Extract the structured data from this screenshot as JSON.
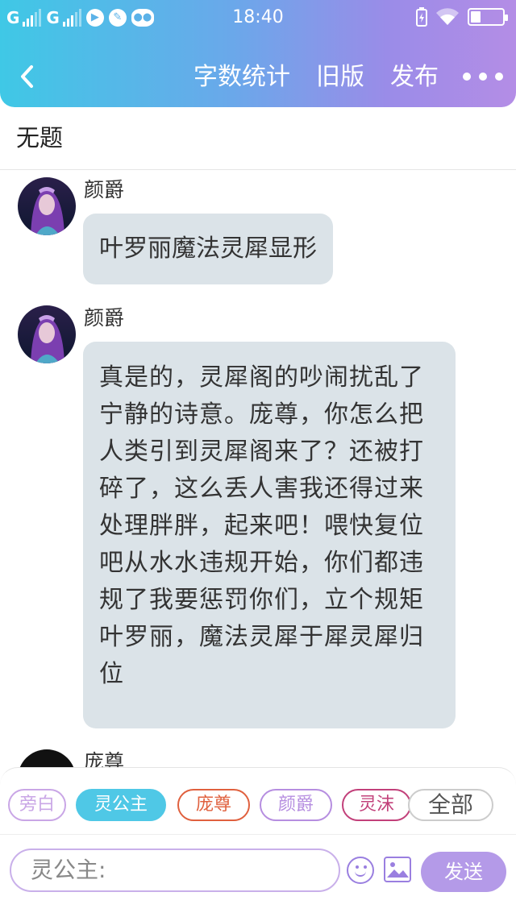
{
  "status_bar": {
    "carrier1": "G",
    "carrier2": "G",
    "time": "18:40"
  },
  "header": {
    "actions": [
      "字数统计",
      "旧版",
      "发布"
    ],
    "back_icon": "chevron-left-icon",
    "more_icon": "more-dots-icon"
  },
  "title": "无题",
  "messages": [
    {
      "sender": "颜爵",
      "text": "叶罗丽魔法灵犀显形"
    },
    {
      "sender": "颜爵",
      "text": "真是的，灵犀阁的吵闹扰乱了宁静的诗意。庞尊，你怎么把人类引到灵犀阁来了？还被打碎了，这么丢人害我还得过来处理胖胖，起来吧！喂快复位吧从水水违规开始，你们都违规了我要惩罚你们，立个规矩叶罗丽，魔法灵犀于犀灵犀归位"
    },
    {
      "sender": "庞尊",
      "text": ""
    }
  ],
  "role_chips": [
    {
      "label": "旁白",
      "color": "#c9a6e6"
    },
    {
      "label": "灵公主",
      "color": "#4fc8e6",
      "selected": true
    },
    {
      "label": "庞尊",
      "color": "#e0603e"
    },
    {
      "label": "颜爵",
      "color": "#b68ee0"
    },
    {
      "label": "灵沫",
      "color": "#c2407a"
    },
    {
      "label": "全部",
      "color": "#cccccc"
    }
  ],
  "input": {
    "placeholder": "灵公主:"
  },
  "send_label": "发送",
  "colors": {
    "accent": "#b49ae8",
    "bubble": "#dbe3e8"
  }
}
